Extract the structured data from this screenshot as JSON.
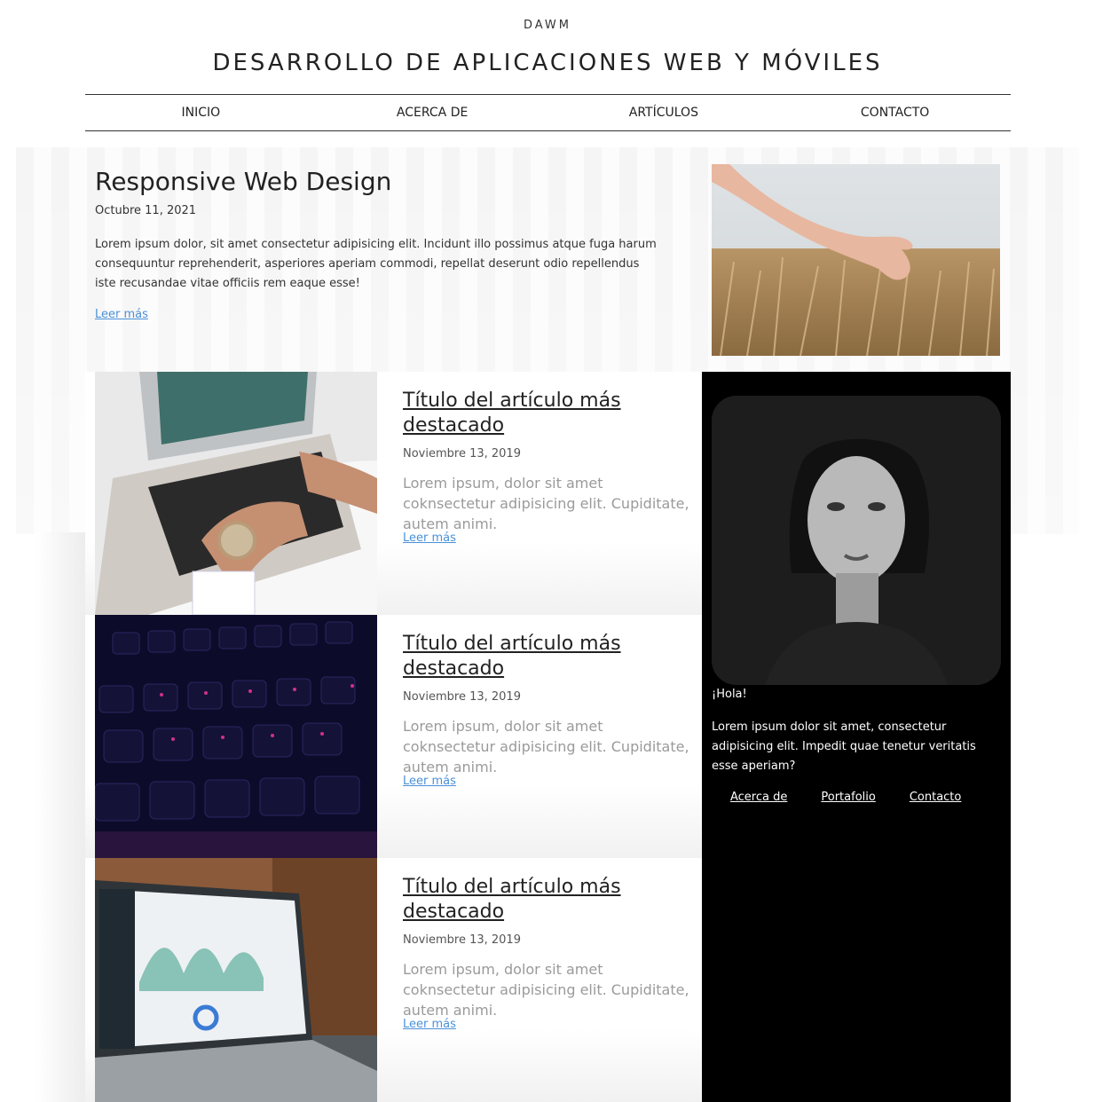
{
  "header": {
    "brand": "DAWM",
    "title": "DESARROLLO DE APLICACIONES WEB Y MÓVILES",
    "nav": [
      "INICIO",
      "ACERCA DE",
      "ARTÍCULOS",
      "CONTACTO"
    ]
  },
  "featured": {
    "title": "Responsive Web Design",
    "date": "Octubre 11, 2021",
    "text": "Lorem ipsum dolor, sit amet consectetur adipisicing elit. Incidunt illo possimus atque fuga harum consequuntur reprehenderit, asperiores aperiam commodi, repellat deserunt odio repellendus iste recusandae vitae officiis rem eaque esse!",
    "link": "Leer más"
  },
  "articles": [
    {
      "title": "Título del artículo más destacado",
      "date": "Noviembre 13, 2019",
      "text": "Lorem ipsum, dolor sit amet coknsectetur adipisicing elit. Cupiditate, autem animi.",
      "link": "Leer más"
    },
    {
      "title": "Título del artículo más destacado",
      "date": "Noviembre 13, 2019",
      "text": "Lorem ipsum, dolor sit amet coknsectetur adipisicing elit. Cupiditate, autem animi.",
      "link": "Leer más"
    },
    {
      "title": "Título del artículo más destacado",
      "date": "Noviembre 13, 2019",
      "text": "Lorem ipsum, dolor sit amet coknsectetur adipisicing elit. Cupiditate, autem animi.",
      "link": "Leer más"
    }
  ],
  "sidebar": {
    "greeting": "¡Hola!",
    "bio": "Lorem ipsum dolor sit amet, consectetur adipisicing elit. Impedit quae tenetur veritatis esse aperiam?",
    "links": [
      "Acerca de",
      "Portafolio",
      "Contacto"
    ]
  },
  "colors": {
    "link": "#4a90d9",
    "sidebar_bg": "#000000"
  }
}
